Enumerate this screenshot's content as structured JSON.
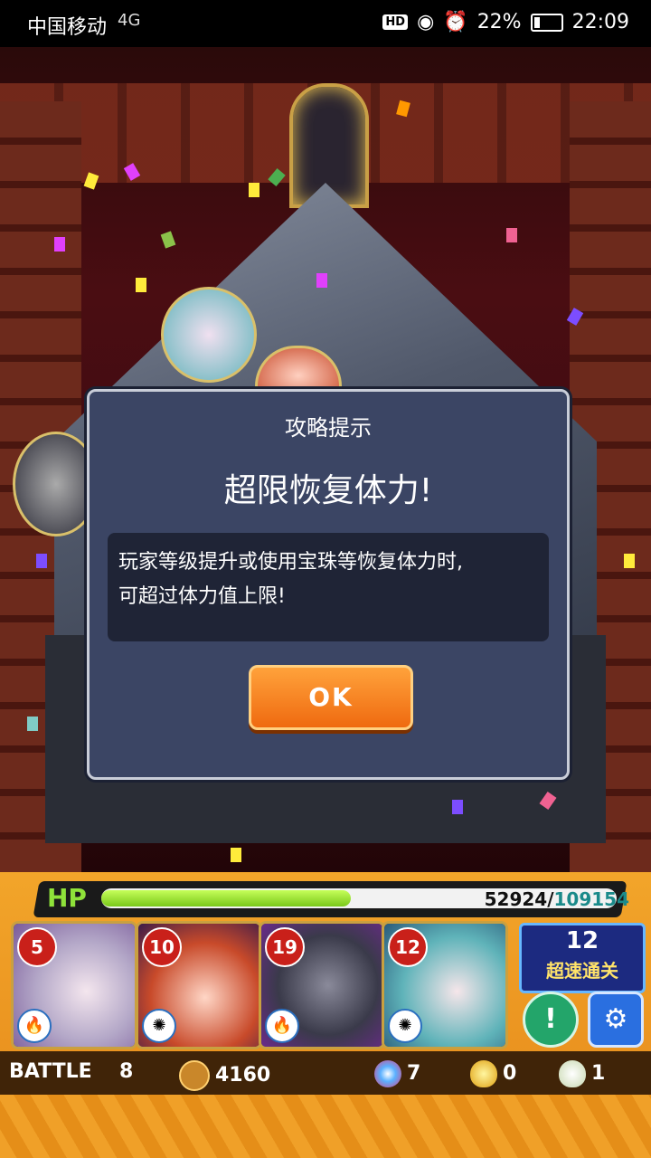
{
  "status_bar": {
    "carrier": "中国移动",
    "network": "4G",
    "battery": "22%",
    "time": "22:09",
    "hd": "HD"
  },
  "dialog": {
    "title": "攻略提示",
    "headline": "超限恢复体力!",
    "body_line1": "玩家等级提升或使用宝珠等恢复体力时,",
    "body_line2": "可超过体力值上限!",
    "ok_label": "OK"
  },
  "hud": {
    "hp_label": "HP",
    "hp_current": "52924/",
    "hp_max": "109154",
    "hp_fraction": 0.485,
    "units": [
      {
        "level": "5",
        "color": "#d9d2e6"
      },
      {
        "level": "10",
        "color": "#c84a2a"
      },
      {
        "level": "19",
        "color": "#3a3a4a"
      },
      {
        "level": "12",
        "color": "#5fb3b9"
      }
    ],
    "speed_clear_count": "12",
    "speed_clear_label": "超速通关",
    "info_button": "!",
    "settings_icon": "⚙",
    "battle_label": "BATTLE",
    "battle_value": "8",
    "coins": "4160",
    "orbs": "7",
    "gold_eggs": "0",
    "eggs": "1"
  }
}
